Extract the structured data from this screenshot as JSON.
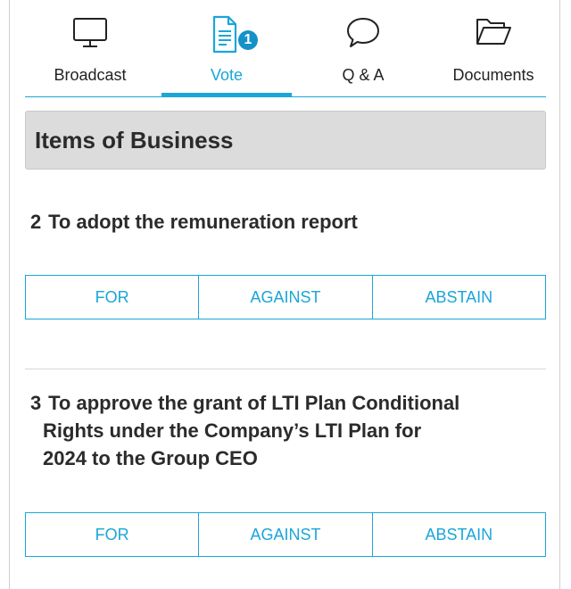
{
  "tabs": [
    {
      "label": "Broadcast",
      "icon": "monitor-icon",
      "active": false
    },
    {
      "label": "Vote",
      "icon": "document-icon",
      "active": true,
      "badge": "1"
    },
    {
      "label": "Q & A",
      "icon": "chat-bubble-icon",
      "active": false
    },
    {
      "label": "Documents",
      "icon": "folder-icon",
      "active": false
    }
  ],
  "section": {
    "title": "Items of Business"
  },
  "items": [
    {
      "number": "2",
      "title_lines": [
        "To adopt the remuneration report"
      ],
      "options": [
        "FOR",
        "AGAINST",
        "ABSTAIN"
      ]
    },
    {
      "number": "3",
      "title_lines": [
        "To approve the grant of LTI Plan Conditional",
        "Rights under the Company’s LTI Plan for",
        "2024 to the Group CEO"
      ],
      "options": [
        "FOR",
        "AGAINST",
        "ABSTAIN"
      ]
    }
  ],
  "colors": {
    "accent": "#1aa6d9",
    "badge": "#1591c9",
    "header_bg": "#dcdcdc",
    "text": "#2b2b2b"
  }
}
